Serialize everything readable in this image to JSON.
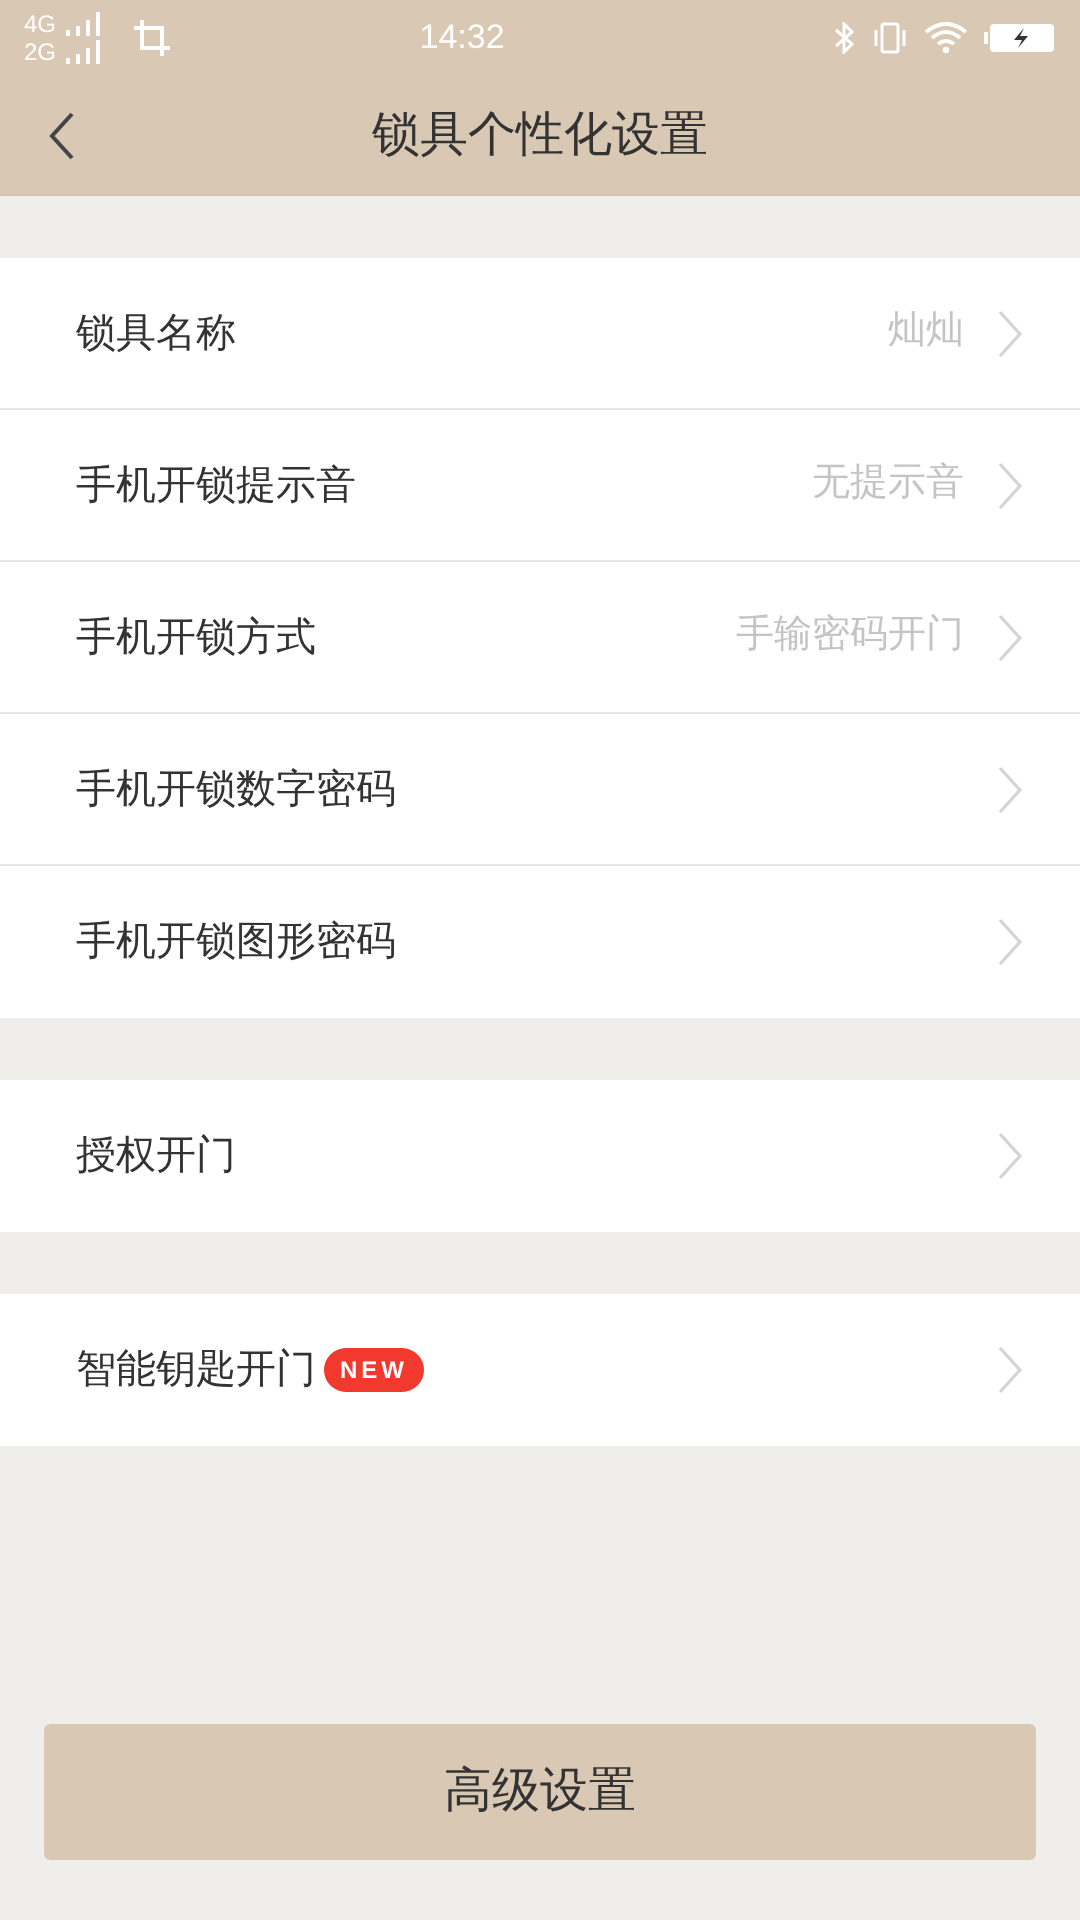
{
  "status_bar": {
    "network_1": "4G",
    "network_2": "2G",
    "time": "14:32"
  },
  "header": {
    "title": "锁具个性化设置"
  },
  "groups": [
    {
      "rows": [
        {
          "label": "锁具名称",
          "value": "灿灿"
        },
        {
          "label": "手机开锁提示音",
          "value": "无提示音"
        },
        {
          "label": "手机开锁方式",
          "value": "手输密码开门"
        },
        {
          "label": "手机开锁数字密码"
        },
        {
          "label": "手机开锁图形密码"
        }
      ]
    },
    {
      "rows": [
        {
          "label": "授权开门"
        }
      ]
    },
    {
      "rows": [
        {
          "label": "智能钥匙开门",
          "badge": "NEW"
        }
      ]
    }
  ],
  "button": "高级设置"
}
